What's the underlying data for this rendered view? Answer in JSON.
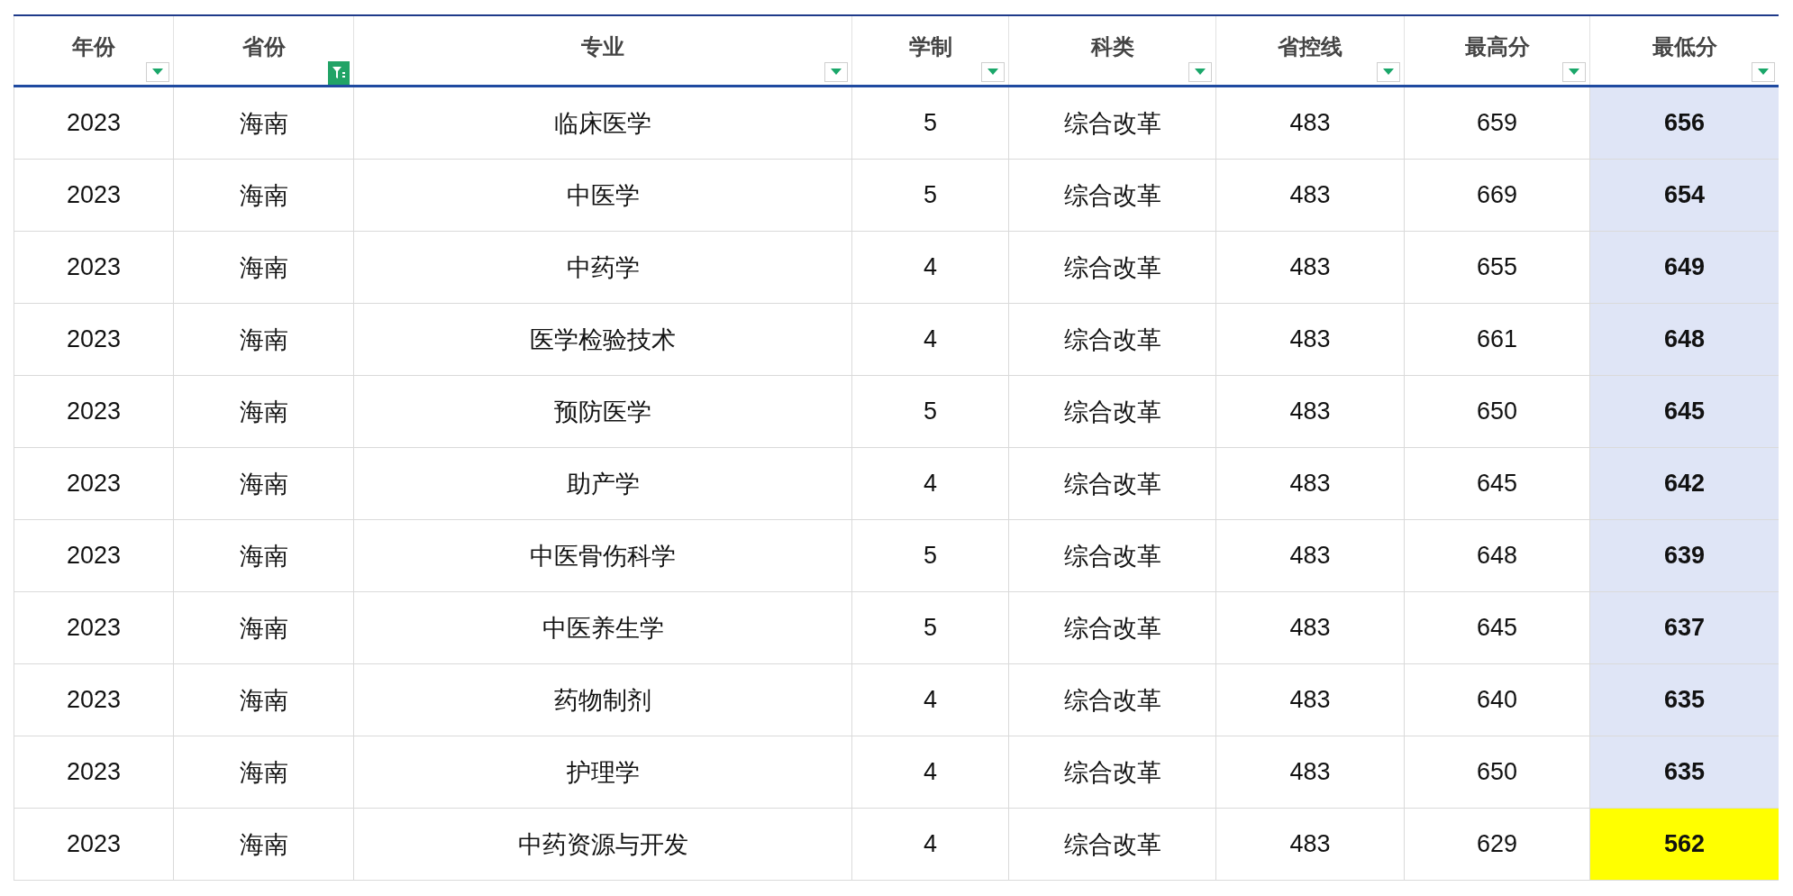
{
  "table": {
    "columns": [
      {
        "label": "年份",
        "filtered": false,
        "shaded": false
      },
      {
        "label": "省份",
        "filtered": true,
        "shaded": false
      },
      {
        "label": "专业",
        "filtered": false,
        "shaded": false
      },
      {
        "label": "学制",
        "filtered": false,
        "shaded": false
      },
      {
        "label": "科类",
        "filtered": false,
        "shaded": false
      },
      {
        "label": "省控线",
        "filtered": false,
        "shaded": false
      },
      {
        "label": "最高分",
        "filtered": false,
        "shaded": false
      },
      {
        "label": "最低分",
        "filtered": false,
        "shaded": true
      }
    ],
    "rows": [
      {
        "cells": [
          "2023",
          "海南",
          "临床医学",
          "5",
          "综合改革",
          "483",
          "659",
          "656"
        ],
        "highlighted": false
      },
      {
        "cells": [
          "2023",
          "海南",
          "中医学",
          "5",
          "综合改革",
          "483",
          "669",
          "654"
        ],
        "highlighted": false
      },
      {
        "cells": [
          "2023",
          "海南",
          "中药学",
          "4",
          "综合改革",
          "483",
          "655",
          "649"
        ],
        "highlighted": false
      },
      {
        "cells": [
          "2023",
          "海南",
          "医学检验技术",
          "4",
          "综合改革",
          "483",
          "661",
          "648"
        ],
        "highlighted": false
      },
      {
        "cells": [
          "2023",
          "海南",
          "预防医学",
          "5",
          "综合改革",
          "483",
          "650",
          "645"
        ],
        "highlighted": false
      },
      {
        "cells": [
          "2023",
          "海南",
          "助产学",
          "4",
          "综合改革",
          "483",
          "645",
          "642"
        ],
        "highlighted": false
      },
      {
        "cells": [
          "2023",
          "海南",
          "中医骨伤科学",
          "5",
          "综合改革",
          "483",
          "648",
          "639"
        ],
        "highlighted": false
      },
      {
        "cells": [
          "2023",
          "海南",
          "中医养生学",
          "5",
          "综合改革",
          "483",
          "645",
          "637"
        ],
        "highlighted": false
      },
      {
        "cells": [
          "2023",
          "海南",
          "药物制剂",
          "4",
          "综合改革",
          "483",
          "640",
          "635"
        ],
        "highlighted": false
      },
      {
        "cells": [
          "2023",
          "海南",
          "护理学",
          "4",
          "综合改革",
          "483",
          "650",
          "635"
        ],
        "highlighted": false
      },
      {
        "cells": [
          "2023",
          "海南",
          "中药资源与开发",
          "4",
          "综合改革",
          "483",
          "629",
          "562"
        ],
        "highlighted": true
      }
    ]
  }
}
